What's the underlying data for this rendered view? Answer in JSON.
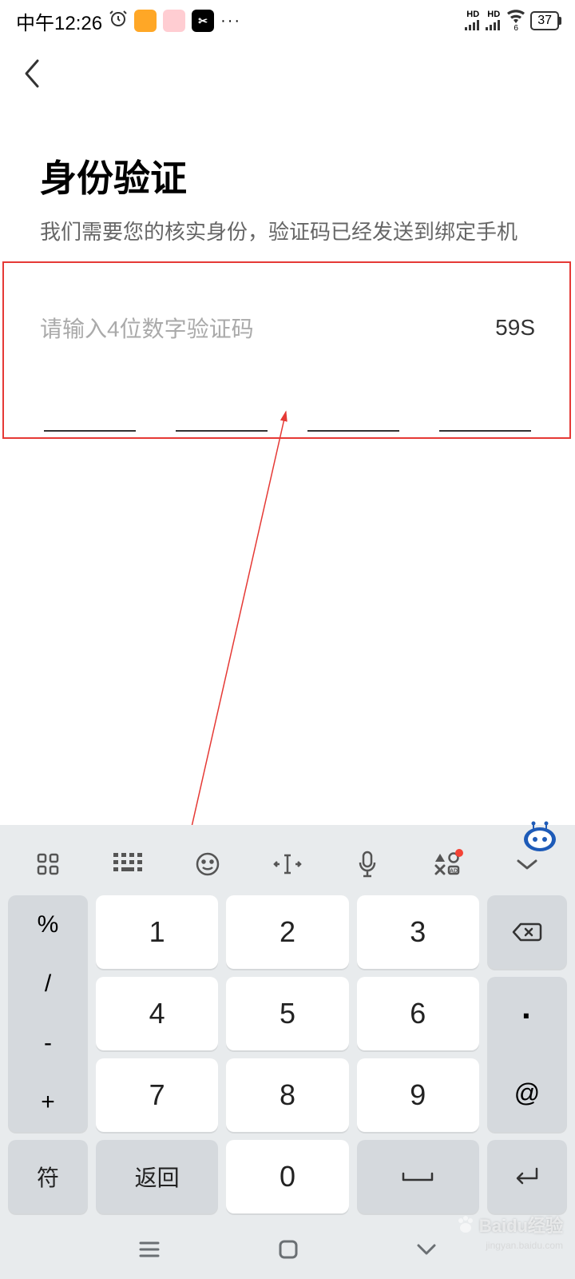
{
  "statusBar": {
    "time": "中午12:26",
    "hdLabel": "HD",
    "wifiSub": "6",
    "battery": "37"
  },
  "page": {
    "title": "身份验证",
    "subtitle": "我们需要您的核实身份，验证码已经发送到绑定手机"
  },
  "input": {
    "placeholder": "请输入4位数字验证码",
    "countdown": "59S"
  },
  "keyboard": {
    "sideLeft": [
      "%",
      "/",
      "-",
      "+"
    ],
    "sideRightTop": [
      "·",
      "@"
    ],
    "row1": [
      "1",
      "2",
      "3"
    ],
    "row2": [
      "4",
      "5",
      "6"
    ],
    "row3": [
      "7",
      "8",
      "9"
    ],
    "bottomLeftLabel": "符",
    "bottomReturnLabel": "返回",
    "bottomZero": "0"
  },
  "watermark": {
    "brand": "Baidu经验",
    "url": "jingyan.baidu.com"
  }
}
